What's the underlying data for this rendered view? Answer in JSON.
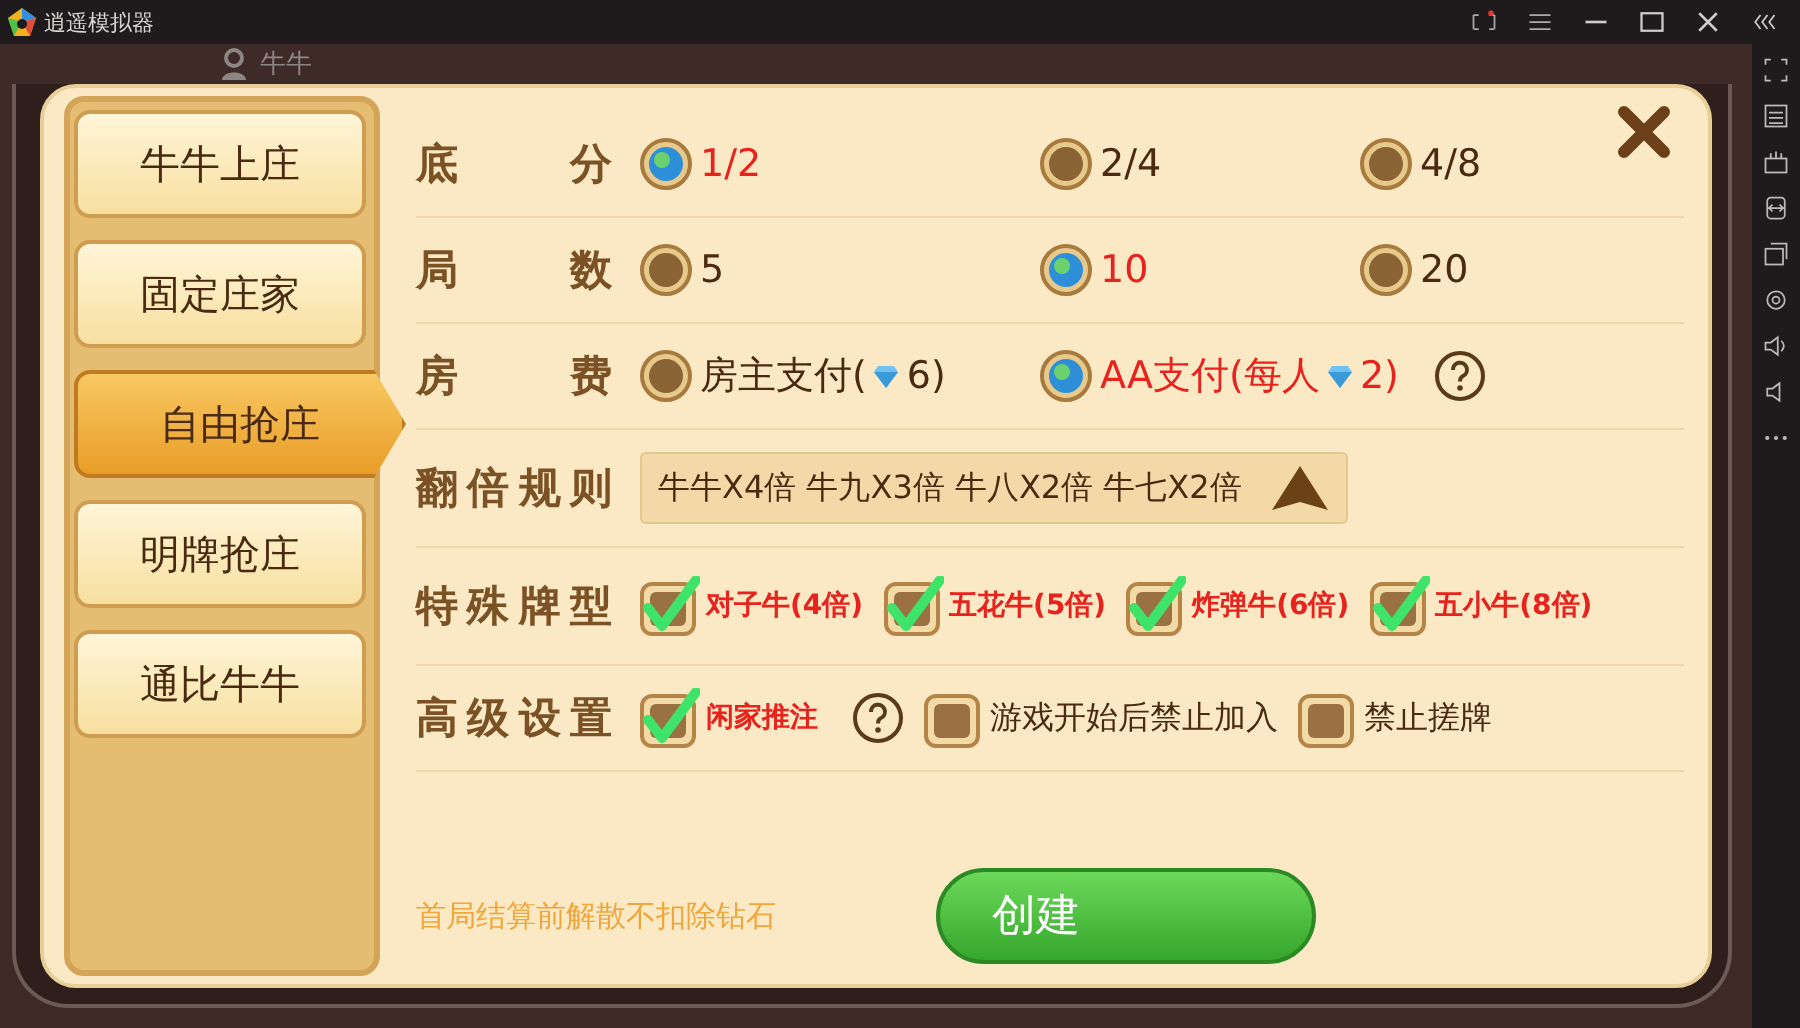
{
  "app_bar": {
    "title": "逍遥模拟器"
  },
  "game_bar": {
    "label": "牛牛"
  },
  "tabs": [
    {
      "label": "牛牛上庄",
      "selected": false
    },
    {
      "label": "固定庄家",
      "selected": false
    },
    {
      "label": "自由抢庄",
      "selected": true
    },
    {
      "label": "明牌抢庄",
      "selected": false
    },
    {
      "label": "通比牛牛",
      "selected": false
    }
  ],
  "settings": [
    {
      "kind": "radio",
      "label": "底分",
      "options": [
        {
          "text": "1/2",
          "selected": true
        },
        {
          "text": "2/4",
          "selected": false
        },
        {
          "text": "4/8",
          "selected": false
        }
      ]
    },
    {
      "kind": "radio",
      "label": "局数",
      "options": [
        {
          "text": "5",
          "selected": false
        },
        {
          "text": "10",
          "selected": true
        },
        {
          "text": "20",
          "selected": false
        }
      ]
    },
    {
      "kind": "radio",
      "label": "房费",
      "options": [
        {
          "text": "房主支付(",
          "after_diamond": "6)",
          "selected": false
        },
        {
          "text": "AA支付(每人",
          "after_diamond": "2)",
          "selected": true,
          "help": true
        }
      ]
    },
    {
      "kind": "dropdown",
      "label": "翻倍规则",
      "value": "牛牛X4倍 牛九X3倍 牛八X2倍 牛七X2倍"
    },
    {
      "kind": "check",
      "label": "特殊牌型",
      "options": [
        {
          "text": "对子牛(4倍)",
          "checked": true
        },
        {
          "text": "五花牛(5倍)",
          "checked": true
        },
        {
          "text": "炸弹牛(6倍)",
          "checked": true
        },
        {
          "text": "五小牛(8倍)",
          "checked": true
        }
      ]
    },
    {
      "kind": "check",
      "label": "高级设置",
      "options": [
        {
          "text": "闲家推注",
          "checked": true,
          "help": true
        },
        {
          "text": "游戏开始后禁止加入",
          "checked": false
        },
        {
          "text": "禁止搓牌",
          "checked": false
        }
      ]
    }
  ],
  "footer": {
    "note": "首局结算前解散不扣除钻石",
    "create_button": "创建"
  }
}
